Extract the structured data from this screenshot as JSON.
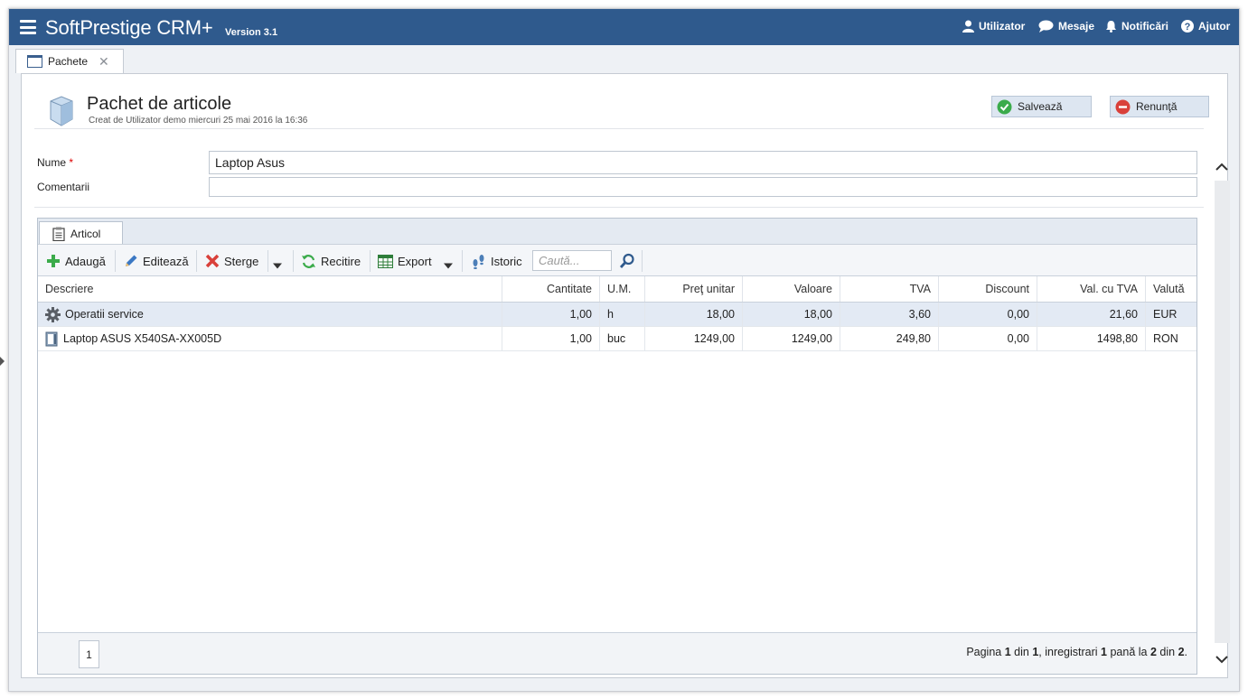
{
  "app": {
    "brand": "SoftPrestige CRM+",
    "version": "Version 3.1",
    "nav": [
      {
        "label": "Utilizator",
        "icon": "user-icon"
      },
      {
        "label": "Mesaje",
        "icon": "chat-icon"
      },
      {
        "label": "Notificări",
        "icon": "bell-icon"
      },
      {
        "label": "Ajutor",
        "icon": "help-icon"
      }
    ]
  },
  "tabs": [
    {
      "label": "Pachete",
      "close": "✕"
    }
  ],
  "header": {
    "title": "Pachet de articole",
    "created": "Creat de Utilizator demo miercuri 25 mai 2016 la 16:36",
    "save_label": "Salvează",
    "cancel_label": "Renunţă"
  },
  "form": {
    "nume_label": "Nume",
    "nume_required": "*",
    "nume_value": "Laptop Asus",
    "comentarii_label": "Comentarii",
    "comentarii_value": ""
  },
  "grid": {
    "tab_label": "Articol",
    "toolbar": {
      "add": "Adaugă",
      "edit": "Editează",
      "delete": "Sterge",
      "reload": "Recitire",
      "export": "Export",
      "history": "Istoric",
      "search_placeholder": "Caută..."
    },
    "columns": [
      "Descriere",
      "Cantitate",
      "U.M.",
      "Preţ unitar",
      "Valoare",
      "TVA",
      "Discount",
      "Val. cu TVA",
      "Valută"
    ],
    "rows": [
      {
        "icon": "gear-icon",
        "descriere": "Operatii service",
        "cantitate": "1,00",
        "um": "h",
        "pret": "18,00",
        "valoare": "18,00",
        "tva": "3,60",
        "discount": "0,00",
        "val_tva": "21,60",
        "valuta": "EUR",
        "selected": true
      },
      {
        "icon": "laptop-icon",
        "descriere": "Laptop ASUS X540SA-XX005D",
        "cantitate": "1,00",
        "um": "buc",
        "pret": "1249,00",
        "valoare": "1249,00",
        "tva": "249,80",
        "discount": "0,00",
        "val_tva": "1498,80",
        "valuta": "RON",
        "selected": false
      }
    ],
    "pager": {
      "current_page": "1",
      "info_pre": "Pagina ",
      "page": "1",
      "info_din": " din ",
      "pages": "1",
      "info_reg": ", inregistrari ",
      "from": "1",
      "info_pana": " pană la ",
      "to": "2",
      "info_din2": " din ",
      "total": "2",
      "info_end": "."
    }
  },
  "colors": {
    "topbar": "#2f5a8d",
    "selected_row": "#e3eaf4",
    "save_icon": "#3bab4b",
    "cancel_icon": "#d9403a"
  }
}
